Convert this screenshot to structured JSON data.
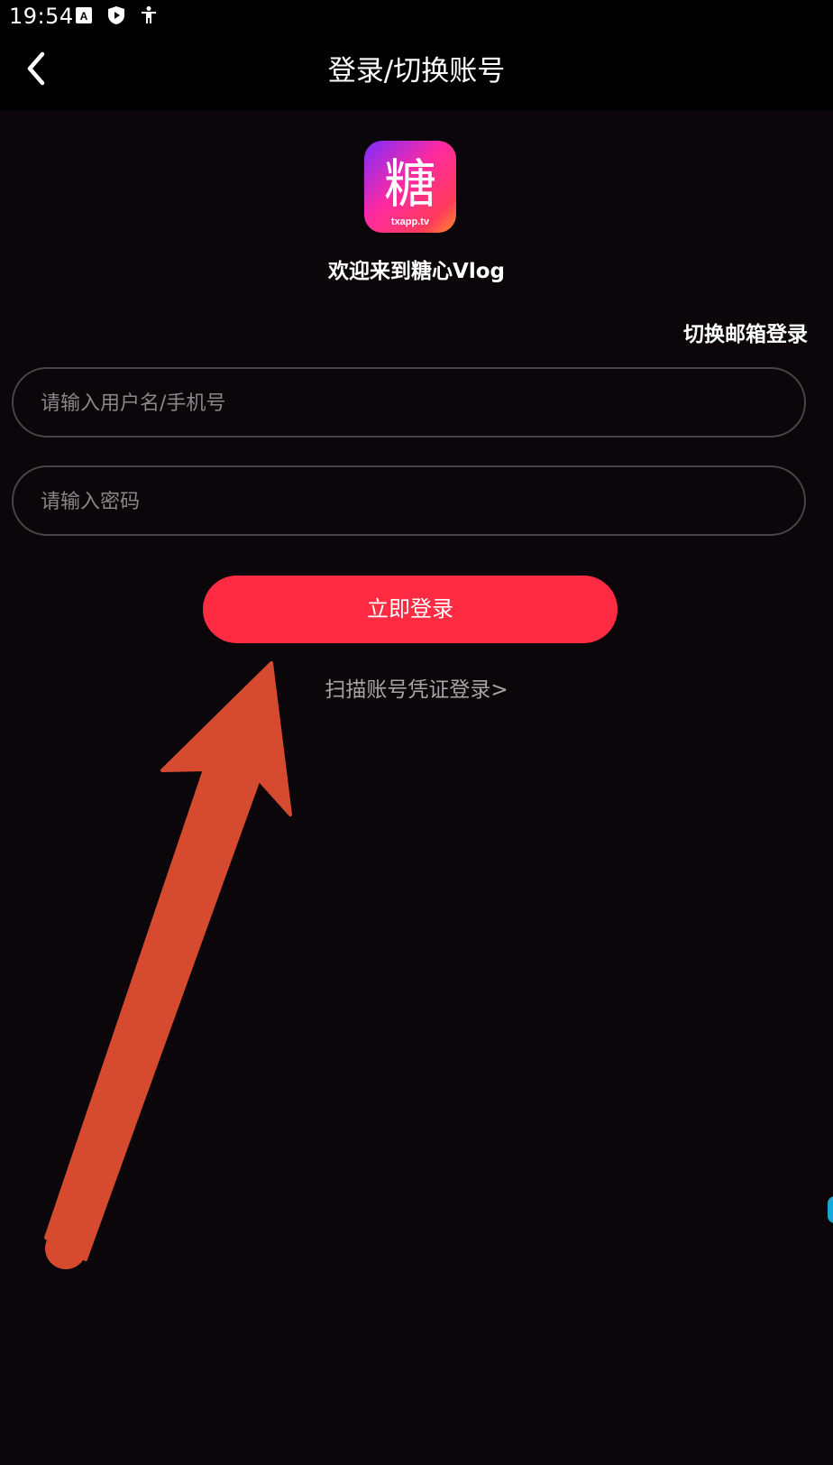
{
  "status_bar": {
    "time": "19:54",
    "icons": [
      "keyboard-a-icon",
      "shield-play-icon",
      "accessibility-icon"
    ]
  },
  "header": {
    "back_icon": "chevron-left-icon",
    "title": "登录/切换账号"
  },
  "app": {
    "logo_text": "糖",
    "logo_subtext": "txapp.tv",
    "welcome": "欢迎来到糖心Vlog"
  },
  "login_form": {
    "switch_email_label": "切换邮箱登录",
    "username_placeholder": "请输入用户名/手机号",
    "username_value": "",
    "password_placeholder": "请输入密码",
    "password_value": "",
    "submit_label": "立即登录",
    "scan_link_label": "扫描账号凭证登录>"
  },
  "colors": {
    "background": "#0b0609",
    "accent": "#ff2b42",
    "arrow": "#d64a30"
  }
}
